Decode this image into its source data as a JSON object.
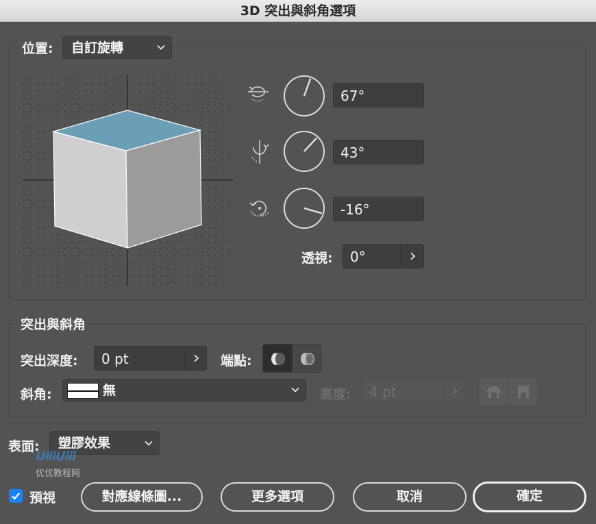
{
  "window": {
    "title": "3D 突出與斜角選項"
  },
  "position": {
    "label": "位置:",
    "preset": "自訂旋轉",
    "rotation_x": "67°",
    "rotation_y": "43°",
    "rotation_z": "-16°",
    "rotation_x_value": 67,
    "rotation_y_value": 43,
    "rotation_z_value": -16,
    "perspective_label": "透視:",
    "perspective": "0°",
    "cube_top_color": "#6a9fb6"
  },
  "extrude": {
    "section_title": "突出與斜角",
    "depth_label": "突出深度:",
    "depth": "0 pt",
    "cap_label": "端點:",
    "bevel_label": "斜角:",
    "bevel": "無",
    "height_label": "高度:",
    "height": "4 pt"
  },
  "surface": {
    "label": "表面:",
    "value": "塑膠效果"
  },
  "watermark": {
    "brand": "UiiiUiii",
    "text": "优优教程网"
  },
  "footer": {
    "preview_label": "預視",
    "preview_checked": true,
    "map_art_button": "對應線條圖...",
    "more_options_button": "更多選項",
    "cancel_button": "取消",
    "ok_button": "確定"
  },
  "colors": {
    "accent": "#1a82f7",
    "panel": "#535353",
    "field": "#3e3e3e"
  }
}
